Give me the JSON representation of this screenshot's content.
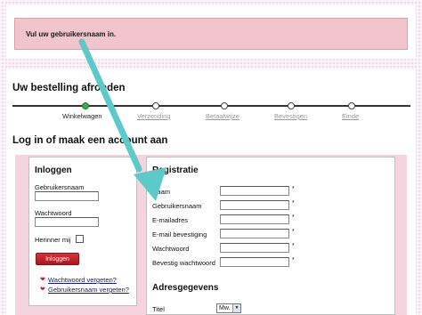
{
  "alert": {
    "message": "Vul uw gebruikersnaam in."
  },
  "checkout": {
    "title": "Uw bestelling afronden",
    "steps": [
      {
        "label": "Winkelwagen",
        "active": true
      },
      {
        "label": "Verzending",
        "active": false
      },
      {
        "label": "Betaalwijze",
        "active": false
      },
      {
        "label": "Bevestigen",
        "active": false
      },
      {
        "label": "Einde",
        "active": false
      }
    ]
  },
  "section_title": "Log in of maak een account aan",
  "login": {
    "title": "Inloggen",
    "username_label": "Gebruikersnaam",
    "password_label": "Wachtwoord",
    "remember_label": "Herinner mij",
    "submit_label": "Inloggen",
    "forgot_password": "Wachtwoord vergeten?",
    "forgot_username": "Gebruikersnaam vergeten?"
  },
  "registration": {
    "title": "Registratie",
    "fields": [
      {
        "label": "Naam",
        "required": "*"
      },
      {
        "label": "Gebruikersnaam",
        "required": "*"
      },
      {
        "label": "E-mailadres",
        "required": "*"
      },
      {
        "label": "E-mail bevestiging",
        "required": "*"
      },
      {
        "label": "Wachtwoord",
        "required": "*"
      },
      {
        "label": "Bevestig wachtwoord",
        "required": "*"
      }
    ]
  },
  "address": {
    "title": "Adresgegevens",
    "title_field_label": "Titel",
    "title_selected": "Mw."
  },
  "colors": {
    "alert_bg": "#f2c4cb",
    "button_red": "#c4232c",
    "arrow_teal": "#5ec9c9",
    "active_step": "#3bb143"
  }
}
